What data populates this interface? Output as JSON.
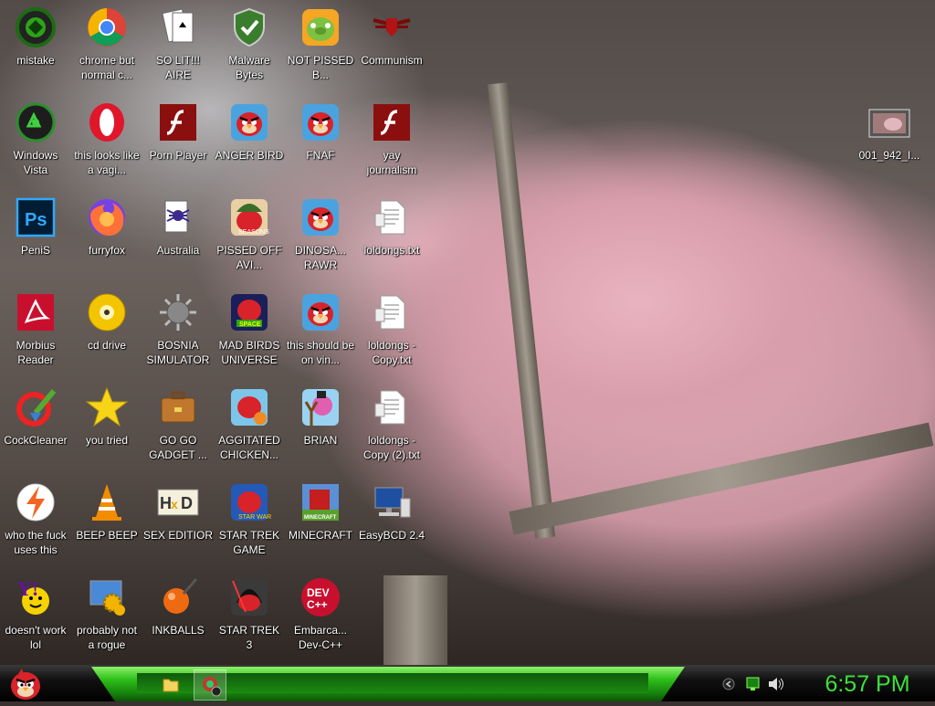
{
  "desktop": {
    "icons": [
      {
        "label": "mistake",
        "icon": "green-circle-icon"
      },
      {
        "label": "chrome but normal c...",
        "icon": "chrome-icon"
      },
      {
        "label": "SO LIT!!! AIRE",
        "icon": "solitaire-cards-icon"
      },
      {
        "label": "Malware Bytes",
        "icon": "shield-check-icon"
      },
      {
        "label": "NOT PISSED B...",
        "icon": "angry-birds-pig-icon"
      },
      {
        "label": "Communism",
        "icon": "winged-shield-icon"
      },
      {
        "label": "Windows Vista",
        "icon": "recycle-icon"
      },
      {
        "label": "this looks like a vagi...",
        "icon": "opera-icon"
      },
      {
        "label": "Porn Player",
        "icon": "flash-icon"
      },
      {
        "label": "ANGER BIRD",
        "icon": "angry-bird-icon"
      },
      {
        "label": "FNAF",
        "icon": "angry-bird-icon"
      },
      {
        "label": "yay journalism",
        "icon": "flash-icon"
      },
      {
        "label": "PeniS",
        "icon": "photoshop-icon"
      },
      {
        "label": "furryfox",
        "icon": "firefox-icon"
      },
      {
        "label": "Australia",
        "icon": "spider-solitaire-icon"
      },
      {
        "label": "PISSED OFF AVI...",
        "icon": "angry-birds-seasons-icon"
      },
      {
        "label": "DINOSA... RAWR",
        "icon": "angry-bird-icon"
      },
      {
        "label": "loldongs.txt",
        "icon": "text-file-icon"
      },
      {
        "label": "Morbius Reader",
        "icon": "pdf-reader-icon"
      },
      {
        "label": "cd drive",
        "icon": "cd-icon"
      },
      {
        "label": "BOSNIA SIMULATOR",
        "icon": "spiked-mine-icon"
      },
      {
        "label": "MAD BIRDS UNIVERSE",
        "icon": "angry-birds-space-icon"
      },
      {
        "label": "this should be on vin...",
        "icon": "angry-bird-icon"
      },
      {
        "label": "loldongs - Copy.txt",
        "icon": "text-file-icon"
      },
      {
        "label": "CockCleaner",
        "icon": "ccleaner-icon"
      },
      {
        "label": "you tried",
        "icon": "star-icon"
      },
      {
        "label": "GO GO GADGET ...",
        "icon": "briefcase-icon"
      },
      {
        "label": "AGGITATED CHICKEN...",
        "icon": "angry-birds-rio-icon"
      },
      {
        "label": "BRIAN",
        "icon": "angry-birds-slingshot-icon"
      },
      {
        "label": "loldongs - Copy (2).txt",
        "icon": "text-file-icon"
      },
      {
        "label": "who the fuck uses this",
        "icon": "winamp-bolt-icon"
      },
      {
        "label": "BEEP BEEP",
        "icon": "vlc-cone-icon"
      },
      {
        "label": "SEX EDITIOR",
        "icon": "hxd-icon"
      },
      {
        "label": "STAR TREK GAME",
        "icon": "angry-birds-star-wars-icon"
      },
      {
        "label": "MINECRAFT",
        "icon": "angry-birds-minecraft-icon"
      },
      {
        "label": "EasyBCD 2.4",
        "icon": "computer-icon"
      },
      {
        "label": "doesn't work lol",
        "icon": "yahoo-messenger-icon"
      },
      {
        "label": "probably not a rogue",
        "icon": "control-panel-gears-icon"
      },
      {
        "label": "INKBALLS",
        "icon": "inkball-icon"
      },
      {
        "label": "STAR TREK 3",
        "icon": "angry-birds-star-wars-2-icon"
      },
      {
        "label": "Embarca... Dev-C++",
        "icon": "dev-cpp-icon"
      },
      {
        "label": "001_942_I...",
        "icon": "image-thumbnail-icon"
      }
    ]
  },
  "taskbar": {
    "start_icon": "angry-bird-start-icon",
    "items": [
      {
        "icon": "folder-icon"
      },
      {
        "icon": "media-app-icon"
      }
    ],
    "tray": [
      {
        "icon": "tray-arrow-icon"
      },
      {
        "icon": "network-monitor-icon"
      },
      {
        "icon": "volume-icon"
      }
    ],
    "clock": "6:57 PM"
  }
}
